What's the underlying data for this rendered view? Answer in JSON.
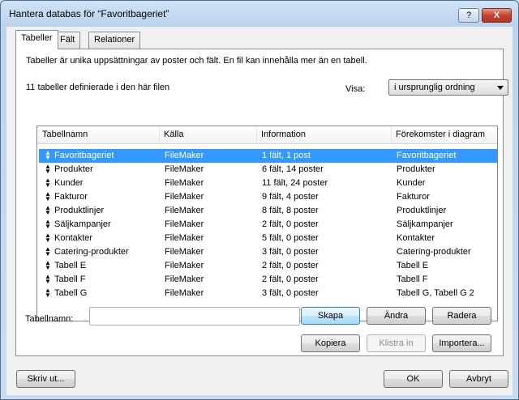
{
  "window": {
    "title": "Hantera databas för “Favoritbageriet”",
    "help_label": "?",
    "close_label": "X"
  },
  "tabs": [
    {
      "label": "Tabeller",
      "active": true
    },
    {
      "label": "Fält",
      "active": false
    },
    {
      "label": "Relationer",
      "active": false
    }
  ],
  "panel": {
    "description": "Tabeller är unika uppsättningar av poster och fält. En fil kan innehålla mer än en tabell.",
    "count_text": "11 tabeller definierade i den här filen",
    "view_label": "Visa:",
    "view_value": "i ursprunglig ordning"
  },
  "table": {
    "headers": [
      "Tabellnamn",
      "Källa",
      "Information",
      "Förekomster i diagram"
    ],
    "rows": [
      {
        "name": "Favoritbageriet",
        "source": "FileMaker",
        "info": "1 fält, 1 post",
        "occurrences": "Favoritbageriet",
        "selected": true
      },
      {
        "name": "Produkter",
        "source": "FileMaker",
        "info": "6 fält, 14 poster",
        "occurrences": "Produkter"
      },
      {
        "name": "Kunder",
        "source": "FileMaker",
        "info": "11 fält, 24 poster",
        "occurrences": "Kunder"
      },
      {
        "name": "Fakturor",
        "source": "FileMaker",
        "info": "9 fält, 4 poster",
        "occurrences": "Fakturor"
      },
      {
        "name": "Produktlinjer",
        "source": "FileMaker",
        "info": "8 fält, 8 poster",
        "occurrences": "Produktlinjer"
      },
      {
        "name": "Säljkampanjer",
        "source": "FileMaker",
        "info": "2 fält, 0 poster",
        "occurrences": "Säljkampanjer"
      },
      {
        "name": "Kontakter",
        "source": "FileMaker",
        "info": "5 fält, 0 poster",
        "occurrences": "Kontakter"
      },
      {
        "name": "Catering-produkter",
        "source": "FileMaker",
        "info": "3 fält, 0 poster",
        "occurrences": "Catering-produkter"
      },
      {
        "name": "Tabell E",
        "source": "FileMaker",
        "info": "2 fält, 0 poster",
        "occurrences": "Tabell E"
      },
      {
        "name": "Tabell F",
        "source": "FileMaker",
        "info": "2 fält, 0 poster",
        "occurrences": "Tabell F"
      },
      {
        "name": "Tabell G",
        "source": "FileMaker",
        "info": "3 fält, 0 poster",
        "occurrences": "Tabell G, Tabell G 2"
      }
    ]
  },
  "form": {
    "name_label": "Tabellnamn:",
    "name_value": "",
    "create_label": "Skapa",
    "change_label": "Ändra",
    "delete_label": "Radera",
    "copy_label": "Kopiera",
    "paste_label": "Klistra in",
    "import_label": "Importera..."
  },
  "footer": {
    "print_label": "Skriv ut...",
    "ok_label": "OK",
    "cancel_label": "Avbryt"
  },
  "colors": {
    "selection": "#3399ff",
    "panel_border": "#898c95"
  }
}
